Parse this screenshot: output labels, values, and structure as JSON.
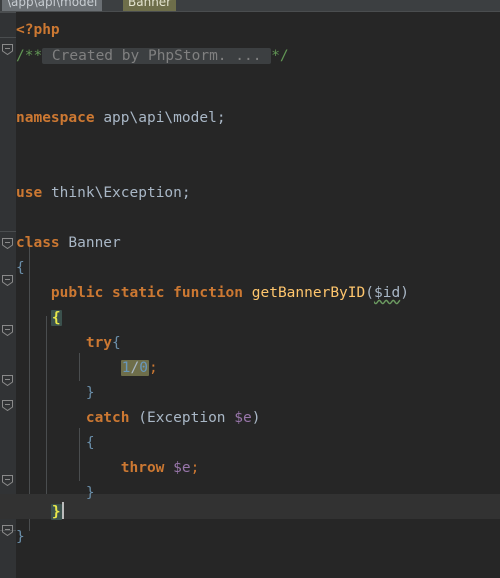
{
  "window": {
    "app": "PhpStorm",
    "theme_bg": "#262626",
    "gutter_bg": "#313335",
    "caret_line_bg": "#323232"
  },
  "breadcrumb": {
    "items": [
      {
        "label": "\\app\\api\\model",
        "kind": "package",
        "bg": "#6a6f73"
      },
      {
        "label": "Banner",
        "kind": "class",
        "bg": "#6e6e4a"
      }
    ]
  },
  "editor": {
    "language": "php",
    "cursor_line_index": 19,
    "lines": [
      {
        "i": 0,
        "text": "<?php"
      },
      {
        "i": 1,
        "text": "/** Created by PhpStorm. ... */"
      },
      {
        "i": 2,
        "text": ""
      },
      {
        "i": 3,
        "text": "namespace app\\api\\model;"
      },
      {
        "i": 4,
        "text": ""
      },
      {
        "i": 5,
        "text": ""
      },
      {
        "i": 6,
        "text": ""
      },
      {
        "i": 7,
        "text": "use think\\Exception;"
      },
      {
        "i": 8,
        "text": ""
      },
      {
        "i": 9,
        "text": ""
      },
      {
        "i": 10,
        "text": "class Banner"
      },
      {
        "i": 11,
        "text": "{"
      },
      {
        "i": 12,
        "text": ""
      },
      {
        "i": 13,
        "text": "    public static function getBannerByID($id)"
      },
      {
        "i": 14,
        "text": "    {"
      },
      {
        "i": 15,
        "text": "        try{"
      },
      {
        "i": 16,
        "text": "            1/0;"
      },
      {
        "i": 17,
        "text": "        }"
      },
      {
        "i": 18,
        "text": "        catch (Exception $e)"
      },
      {
        "i": 19,
        "text": "        {"
      },
      {
        "i": 20,
        "text": "            throw $e;"
      },
      {
        "i": 21,
        "text": "        }"
      },
      {
        "i": 22,
        "text": "    }"
      },
      {
        "i": 23,
        "text": "}"
      }
    ],
    "tokens": {
      "php_open": "<?php",
      "comment_open": "/**",
      "comment_folded": " Created by PhpStorm. ... ",
      "comment_close": "*/",
      "kw_namespace": "namespace",
      "namespace_value": "app\\api\\model",
      "kw_use": "use",
      "use_value": "think\\Exception",
      "kw_class": "class",
      "class_name": "Banner",
      "kw_public": "public",
      "kw_static": "static",
      "kw_function": "function",
      "method_name": "getBannerByID",
      "param": "$id",
      "kw_try": "try",
      "expr_numerator": "1",
      "expr_operator": "/",
      "expr_denominator": "0",
      "kw_catch": "catch",
      "exception_type": "Exception",
      "exception_var": "$e",
      "kw_throw": "throw",
      "semicolon": ";",
      "paren_open": "(",
      "paren_close": ")",
      "brace_open": "{",
      "brace_close": "}"
    },
    "colors": {
      "keyword": "#cc7832",
      "method": "#ffc66d",
      "variable": "#9876aa",
      "number": "#6897bb",
      "comment": "#629755",
      "text": "#a9b7c6",
      "folded_bg": "#3c3f41",
      "folded_fg": "#808080",
      "warning_highlight": "#6e6e4a",
      "brace_match_bg": "#3b514d",
      "brace_match_fg": "#e8e84a",
      "brace_blue": "#6a8ea9"
    },
    "annotations": {
      "folded_comment": " Created by PhpStorm. ... ",
      "warning_expression": "1/0",
      "unused_param_squiggle": "$id"
    }
  },
  "gutter": {
    "icon": "fold-collapse-icon",
    "fold_marker_rows": [
      1,
      10,
      13,
      15,
      18,
      19,
      22,
      23
    ]
  }
}
